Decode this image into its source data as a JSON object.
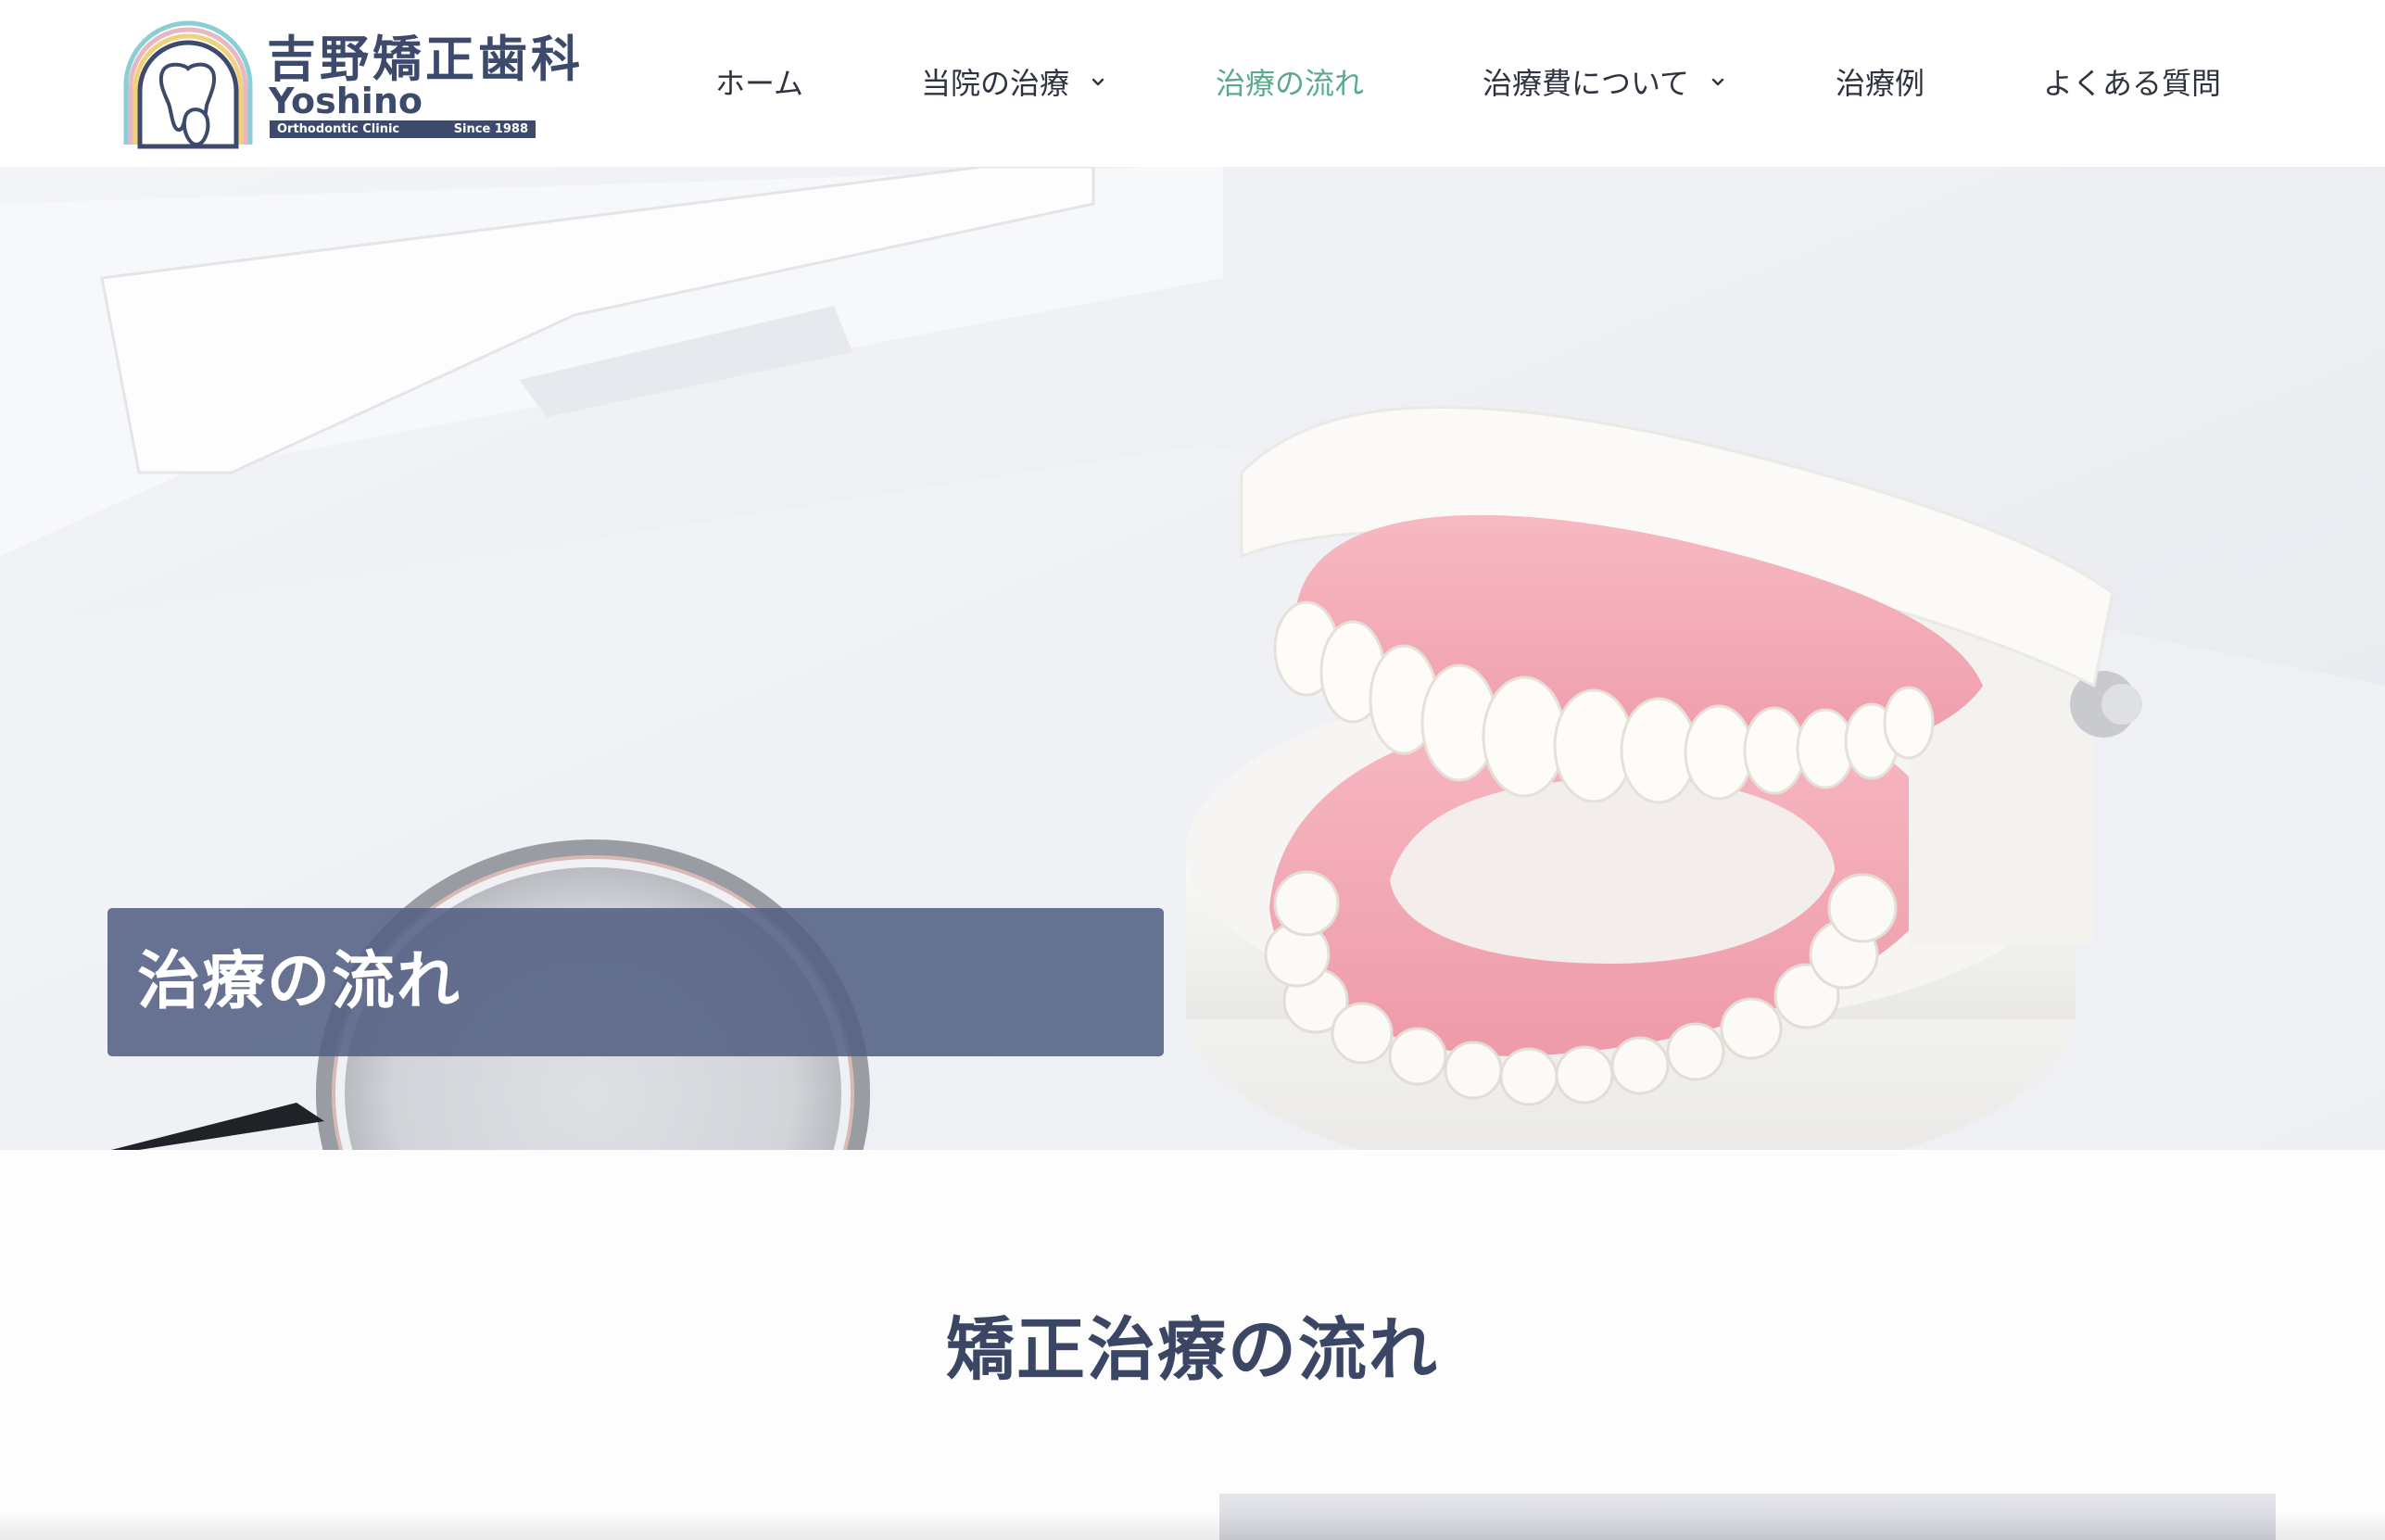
{
  "header": {
    "logo": {
      "kanji": "吉野矯正歯科",
      "roman": "Yoshino",
      "subtitle": "Orthodontic  Clinic",
      "since": "Since 1988"
    },
    "nav": [
      {
        "label": "ホーム",
        "has_dropdown": false,
        "active": false
      },
      {
        "label": "当院の治療",
        "has_dropdown": true,
        "active": false
      },
      {
        "label": "治療の流れ",
        "has_dropdown": false,
        "active": true
      },
      {
        "label": "治療費について",
        "has_dropdown": true,
        "active": false
      },
      {
        "label": "治療例",
        "has_dropdown": false,
        "active": false
      },
      {
        "label": "よくある質問",
        "has_dropdown": false,
        "active": false
      }
    ]
  },
  "hero": {
    "title": "治療の流れ"
  },
  "section": {
    "title": "矯正治療の流れ"
  },
  "colors": {
    "brand_navy": "#3d4a6b",
    "nav_active": "#5aab8b",
    "hero_overlay": "#536084",
    "gum_pink": "#f2a8b4"
  },
  "icons": {
    "logo_mark": "tooth-rainbow-icon",
    "dropdown": "chevron-down-icon"
  }
}
